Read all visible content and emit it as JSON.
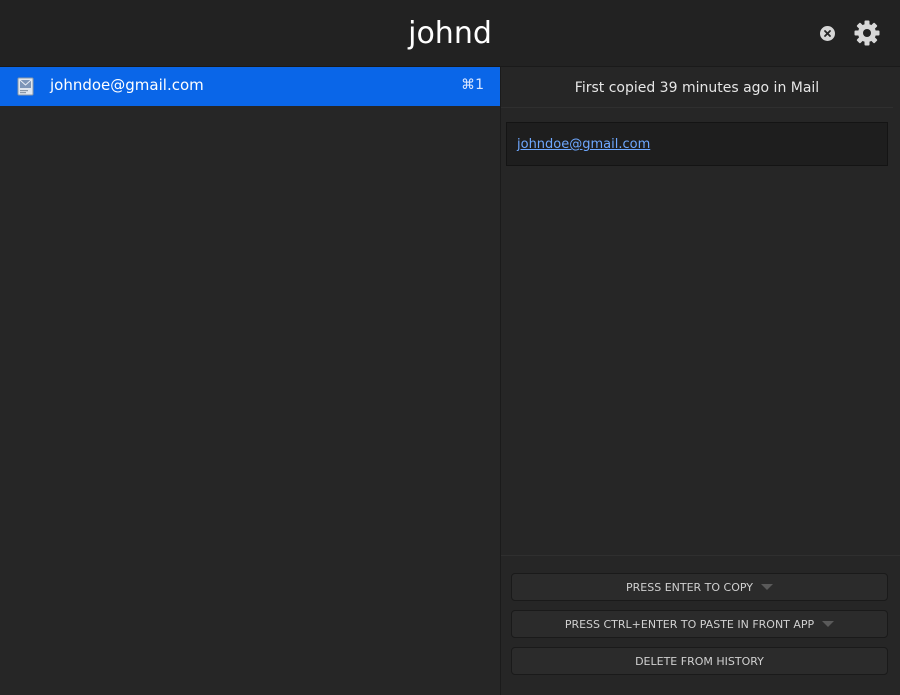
{
  "search": {
    "query": "johnd"
  },
  "icons": {
    "clear": "clear-circle-icon",
    "settings": "gear-icon",
    "app": "mail-app-icon"
  },
  "clips": [
    {
      "text": "johndoe@gmail.com",
      "shortcut": "⌘1",
      "selected": true
    }
  ],
  "detail": {
    "info": "First copied 39 minutes ago in Mail",
    "preview_link": "johndoe@gmail.com"
  },
  "actions": {
    "copy_label": "PRESS ENTER TO COPY",
    "paste_label": "PRESS CTRL+ENTER TO PASTE IN FRONT APP",
    "delete_label": "DELETE FROM HISTORY"
  },
  "colors": {
    "accent": "#0a66e8",
    "background": "#262626",
    "link": "#6ea8ff"
  }
}
